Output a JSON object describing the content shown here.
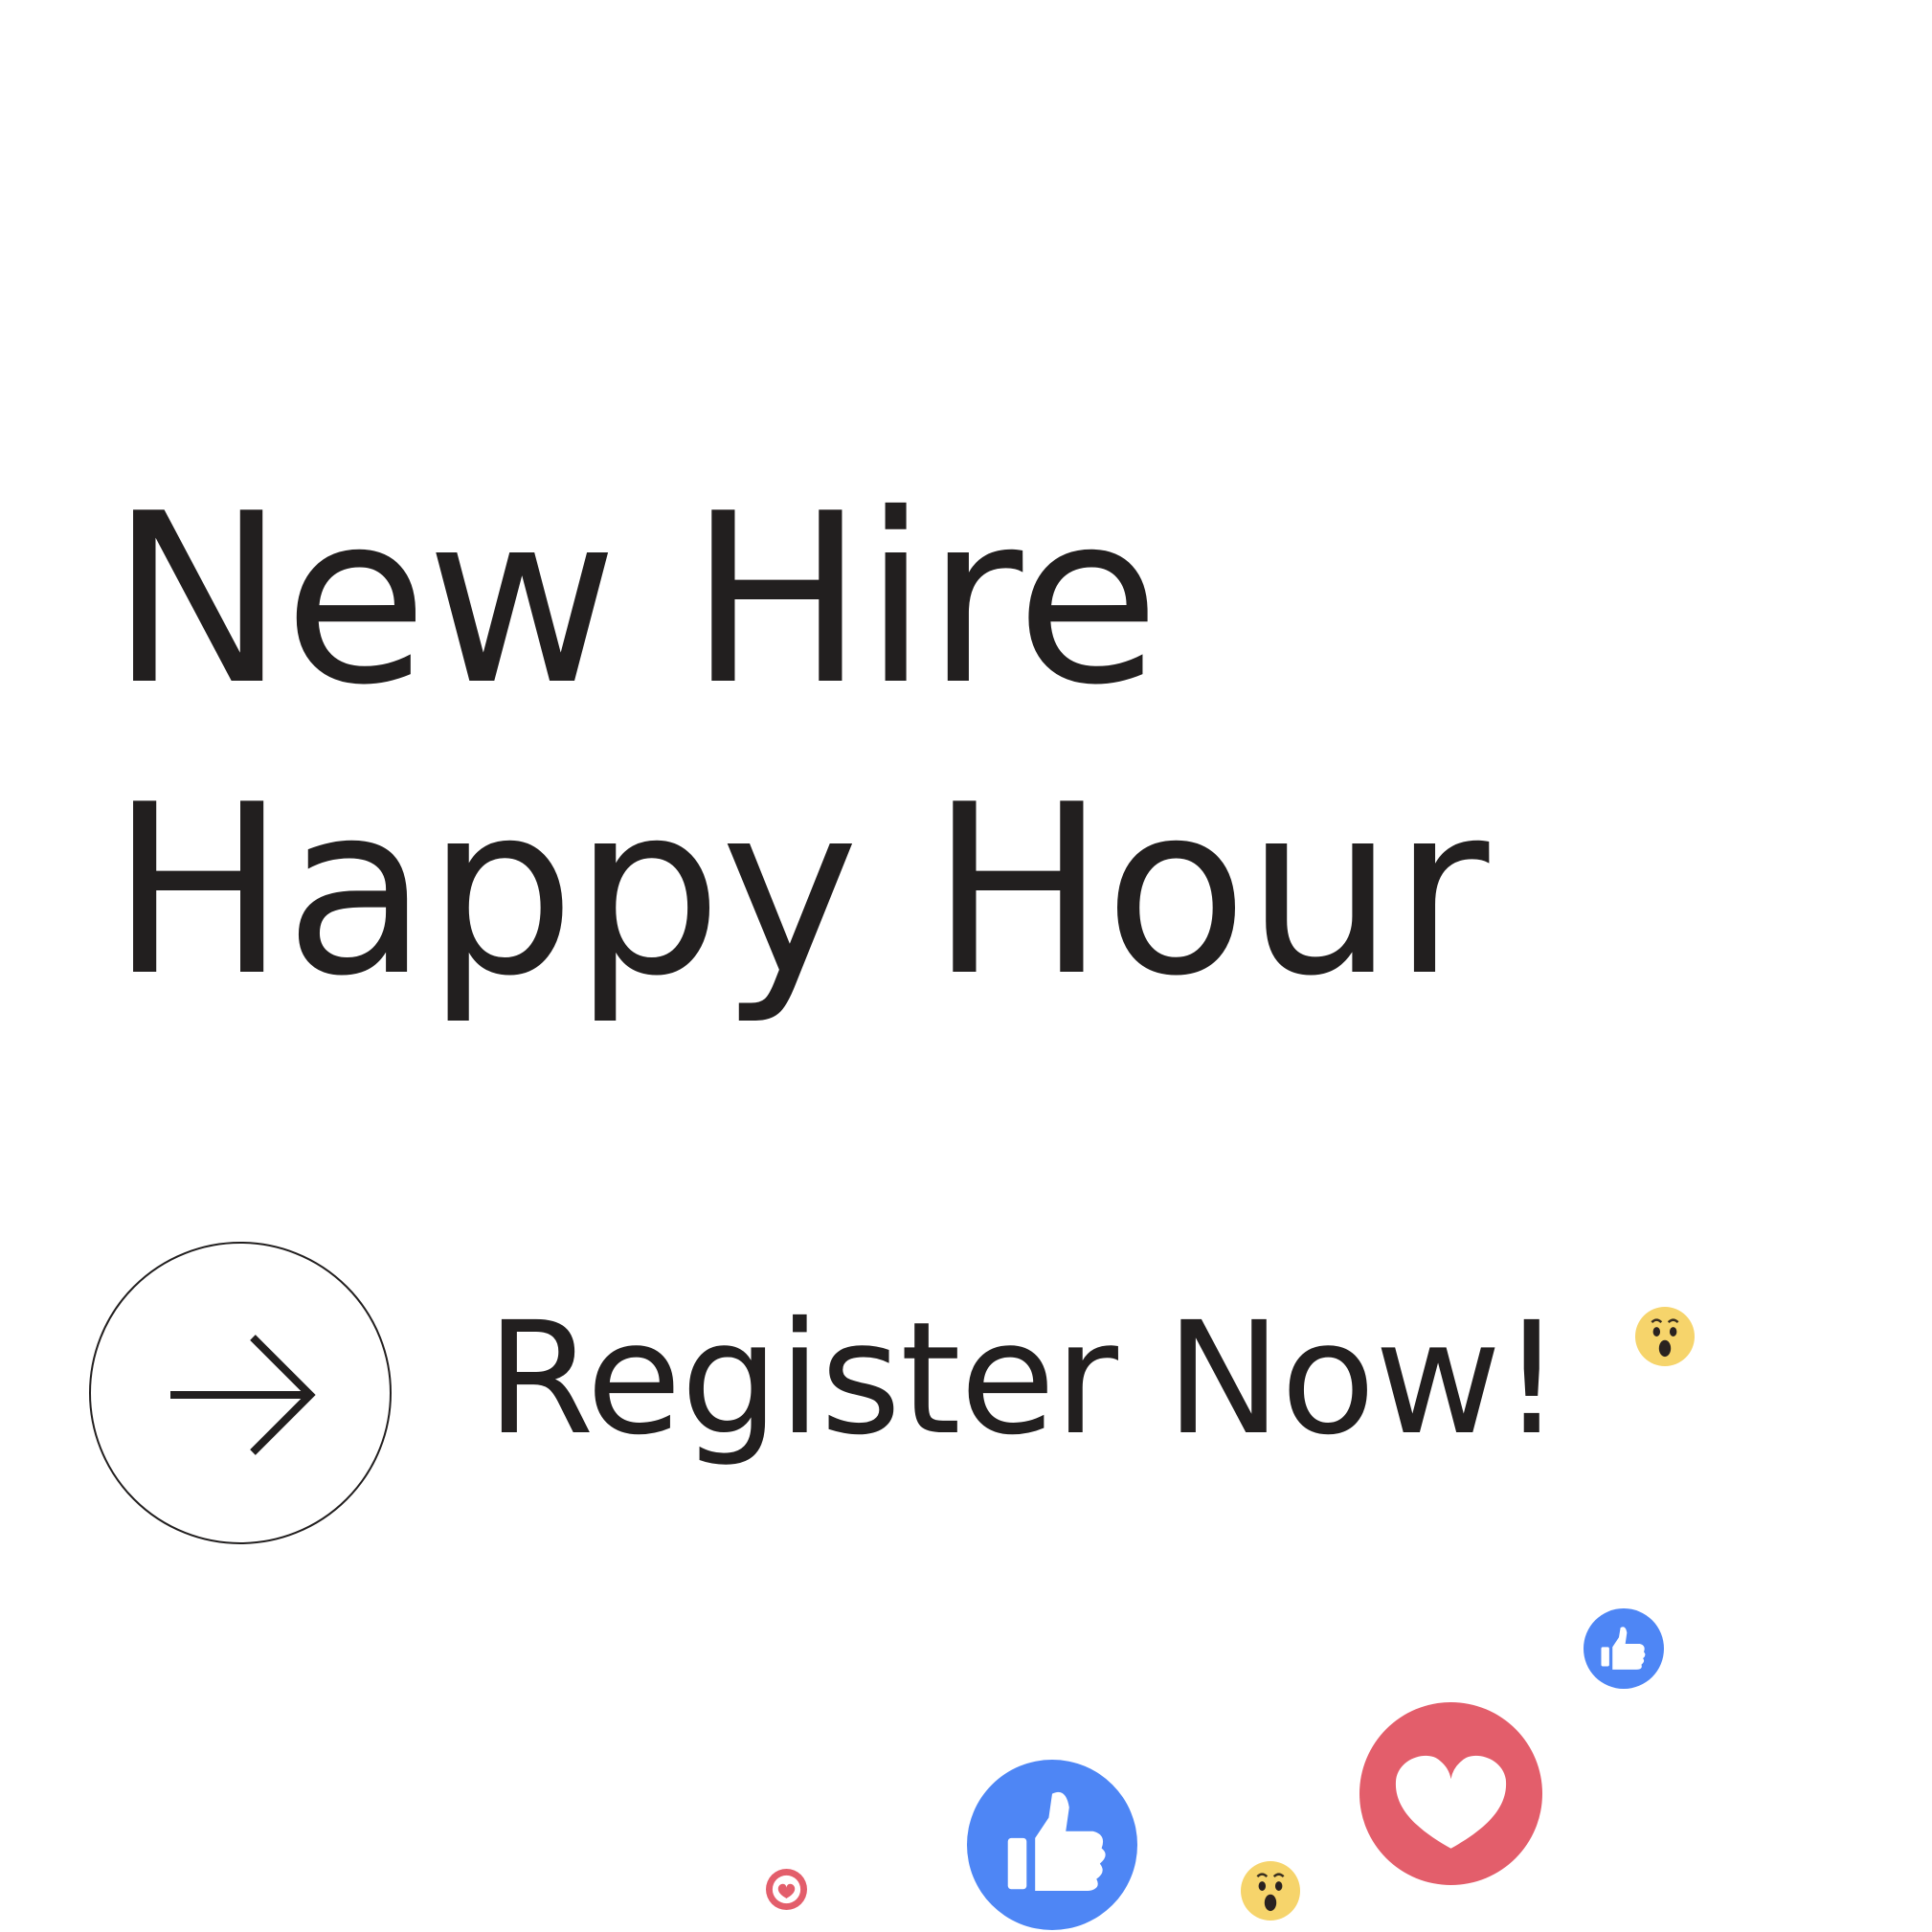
{
  "headline": {
    "line1": "New Hire",
    "line2": "Happy Hour"
  },
  "cta": {
    "label": "Register Now!",
    "icon": "arrow-right-icon"
  },
  "reactions": [
    {
      "icon": "wow-icon",
      "color": "#f6d46b"
    },
    {
      "icon": "like-icon",
      "color": "#4e86f5"
    },
    {
      "icon": "love-icon",
      "color": "#e35e6b"
    },
    {
      "icon": "like-icon",
      "color": "#4e86f5"
    },
    {
      "icon": "wow-icon",
      "color": "#f6d46b"
    },
    {
      "icon": "love-icon",
      "color": "#e35e6b"
    }
  ],
  "colors": {
    "text": "#221f1f",
    "background": "#ffffff",
    "like": "#4e86f5",
    "love": "#e35e6b",
    "wow": "#f6d46b"
  }
}
